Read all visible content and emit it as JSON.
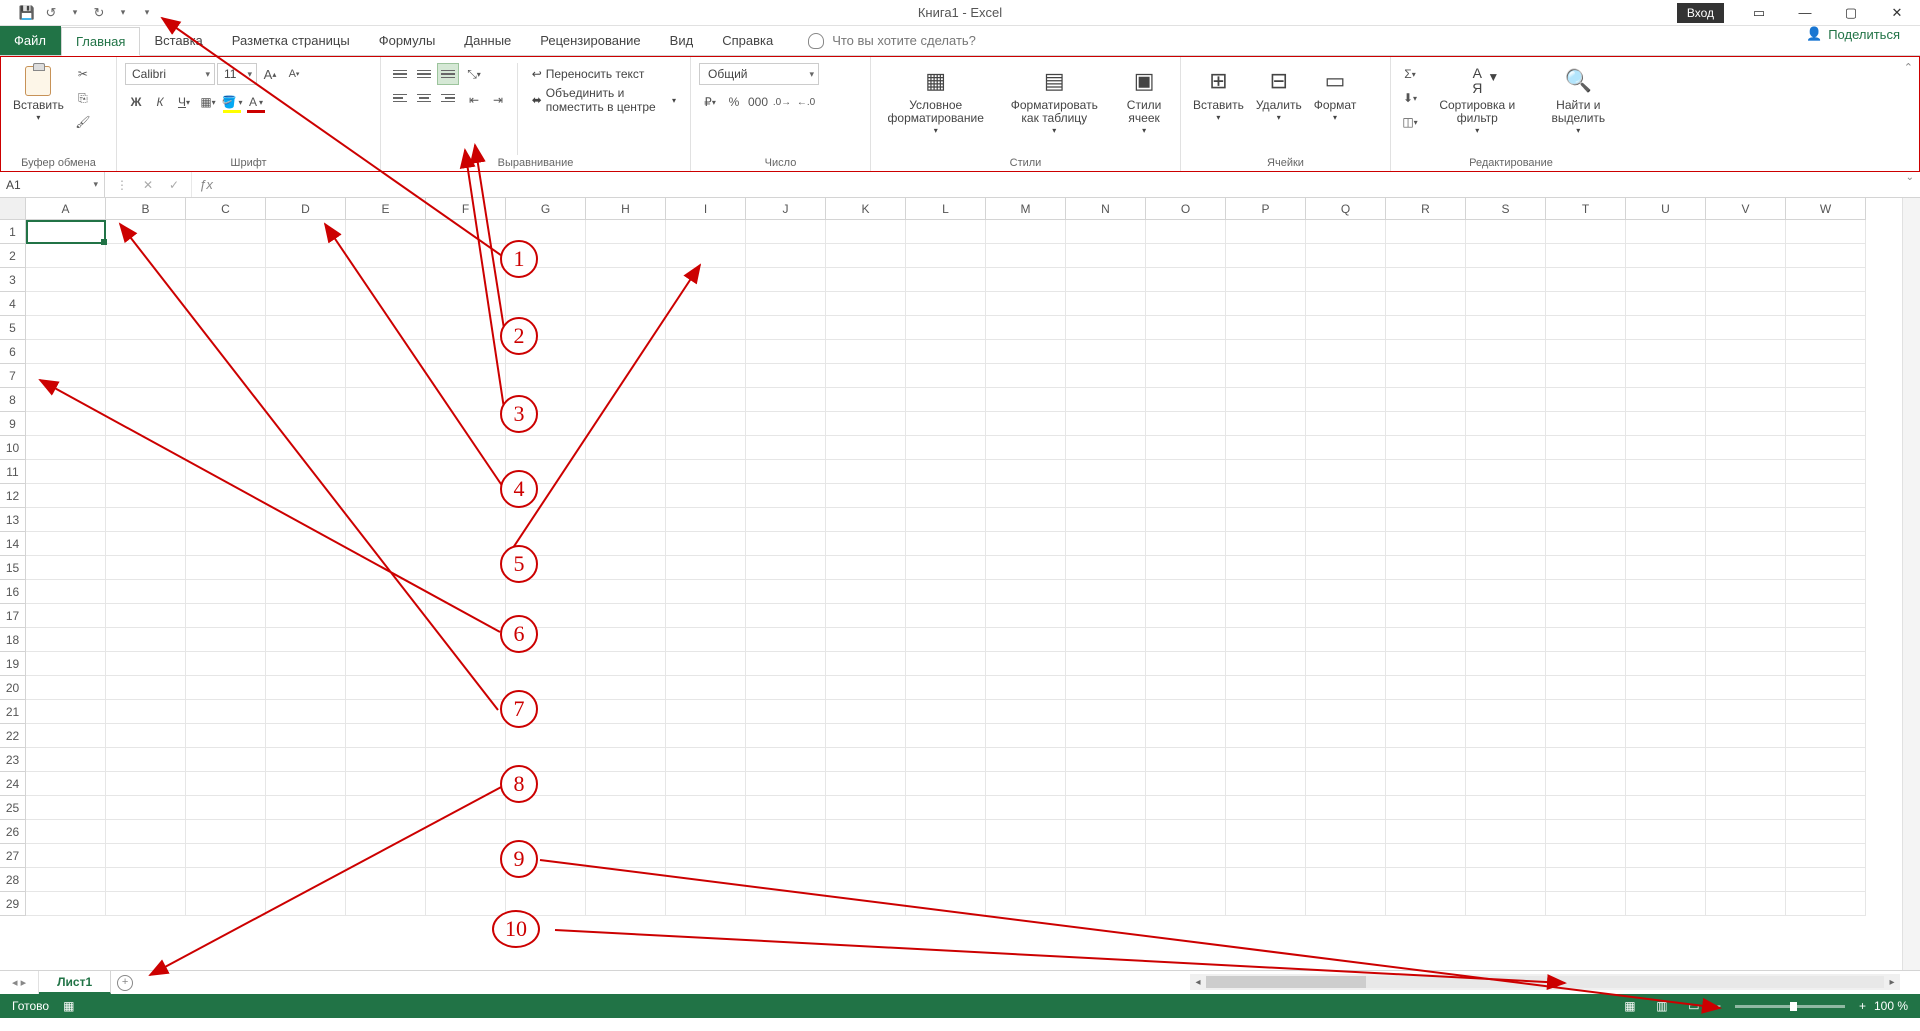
{
  "titlebar": {
    "title": "Книга1  -  Excel",
    "login": "Вход"
  },
  "tabs": {
    "file": "Файл",
    "items": [
      "Главная",
      "Вставка",
      "Разметка страницы",
      "Формулы",
      "Данные",
      "Рецензирование",
      "Вид",
      "Справка"
    ],
    "active_index": 0,
    "tellme": "Что вы хотите сделать?",
    "share": "Поделиться"
  },
  "ribbon": {
    "clipboard": {
      "paste": "Вставить",
      "label": "Буфер обмена"
    },
    "font": {
      "name": "Calibri",
      "size": "11",
      "bold": "Ж",
      "italic": "К",
      "underline": "Ч",
      "label": "Шрифт"
    },
    "alignment": {
      "wrap": "Переносить текст",
      "merge": "Объединить и поместить в центре",
      "label": "Выравнивание"
    },
    "number": {
      "format": "Общий",
      "label": "Число"
    },
    "styles": {
      "conditional": "Условное форматирование",
      "table": "Форматировать как таблицу",
      "cellstyles": "Стили ячеек",
      "label": "Стили"
    },
    "cells": {
      "insert": "Вставить",
      "delete": "Удалить",
      "format": "Формат",
      "label": "Ячейки"
    },
    "editing": {
      "sort": "Сортировка и фильтр",
      "find": "Найти и выделить",
      "label": "Редактирование"
    }
  },
  "formula_bar": {
    "name_box": "A1"
  },
  "columns": [
    "A",
    "B",
    "C",
    "D",
    "E",
    "F",
    "G",
    "H",
    "I",
    "J",
    "K",
    "L",
    "M",
    "N",
    "O",
    "P",
    "Q",
    "R",
    "S",
    "T",
    "U",
    "V",
    "W"
  ],
  "row_count": 29,
  "sheet": {
    "tab1": "Лист1"
  },
  "statusbar": {
    "ready": "Готово",
    "zoom": "100 %"
  },
  "annotations": [
    "1",
    "2",
    "3",
    "4",
    "5",
    "6",
    "7",
    "8",
    "9",
    "10"
  ]
}
